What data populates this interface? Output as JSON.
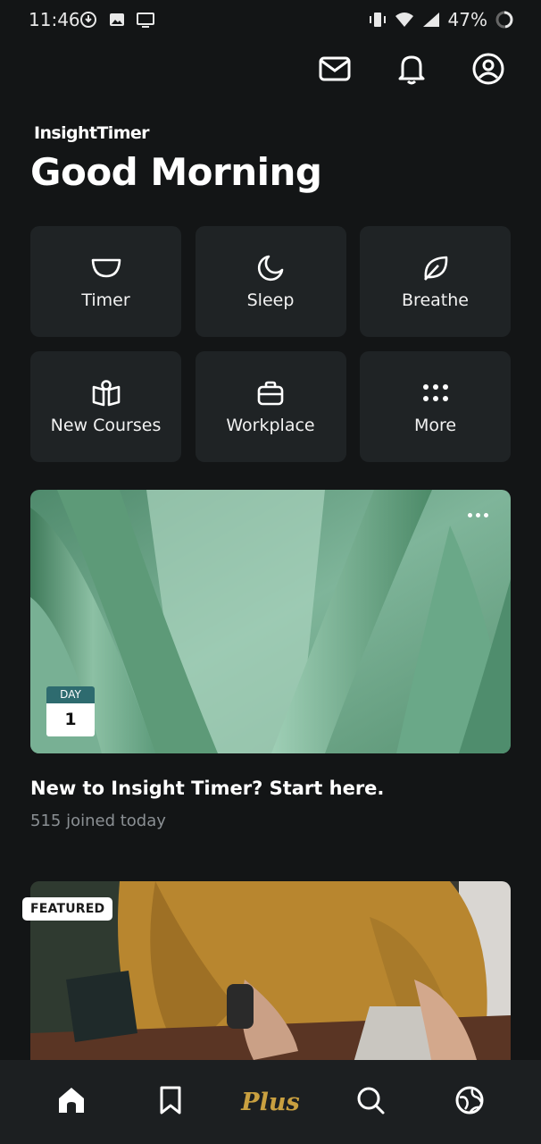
{
  "status_bar": {
    "time": "11:46",
    "battery": "47%"
  },
  "header": {
    "brand": "InsightTimer",
    "greeting": "Good Morning"
  },
  "tiles": [
    {
      "label": "Timer",
      "icon": "bowl-icon"
    },
    {
      "label": "Sleep",
      "icon": "moon-icon"
    },
    {
      "label": "Breathe",
      "icon": "leaf-icon"
    },
    {
      "label": "New Courses",
      "icon": "book-icon"
    },
    {
      "label": "Workplace",
      "icon": "briefcase-icon"
    },
    {
      "label": "More",
      "icon": "grid-dots-icon"
    }
  ],
  "course_card": {
    "day_label": "DAY",
    "day_number": "1",
    "title": "New to Insight Timer? Start here.",
    "subtitle": "515 joined today"
  },
  "featured_card": {
    "badge": "FEATURED"
  },
  "bottom_nav": {
    "plus_label": "Plus"
  },
  "colors": {
    "background": "#131516",
    "tile": "#1f2325",
    "accent": "#c9a040",
    "day_badge": "#2e6b6f"
  }
}
